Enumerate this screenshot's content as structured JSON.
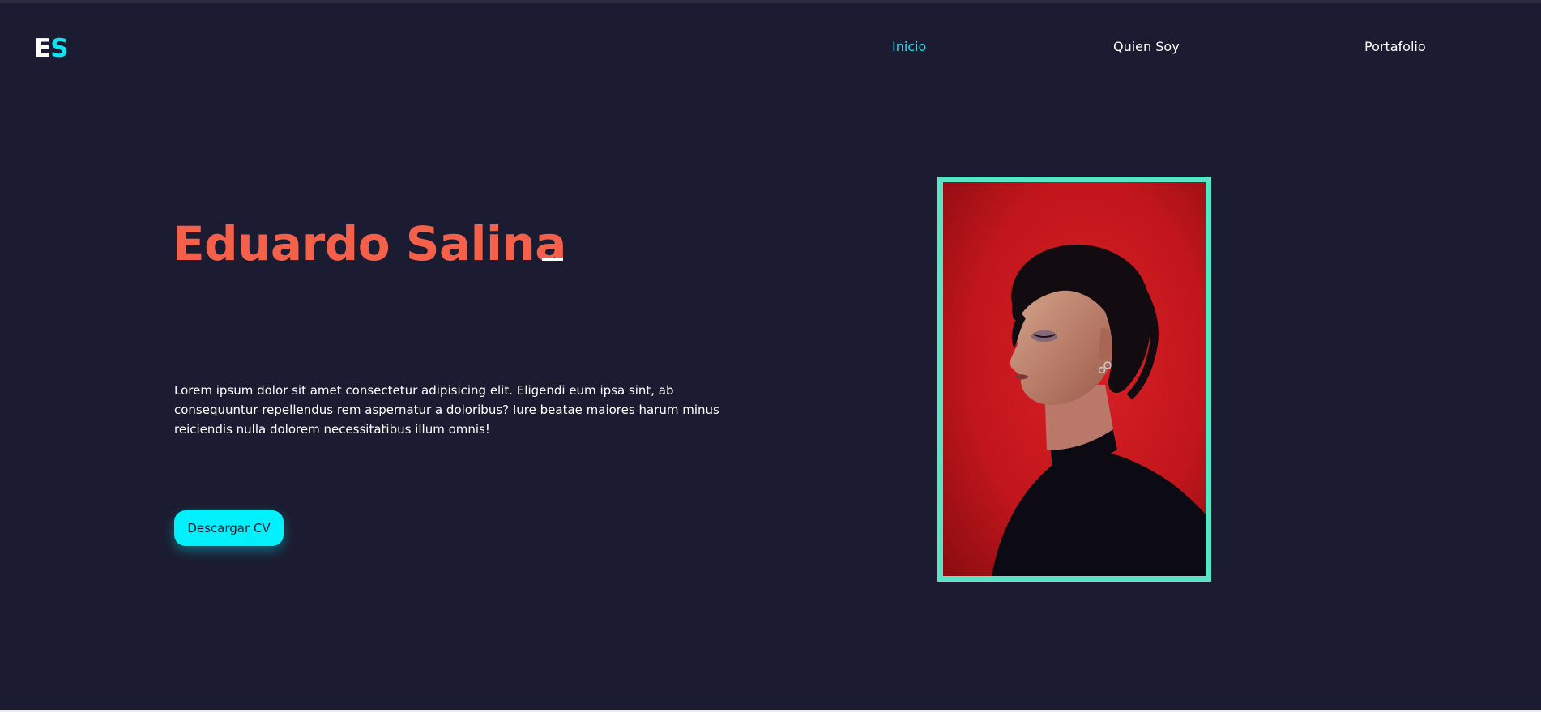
{
  "header": {
    "logo": {
      "first": "E",
      "second": "S"
    },
    "nav": [
      {
        "label": "Inicio",
        "active": true
      },
      {
        "label": "Quien Soy",
        "active": false
      },
      {
        "label": "Portafolio",
        "active": false
      }
    ]
  },
  "hero": {
    "name": "Eduardo Salina",
    "description": "Lorem ipsum dolor sit amet consectetur adipisicing elit. Eligendi eum ipsa sint, ab consequuntur repellendus rem aspernatur a doloribus? Iure beatae maiores harum minus reiciendis nulla dolorem necessitatibus illum omnis!",
    "cv_button": "Descargar CV"
  },
  "colors": {
    "background": "#1b1c31",
    "accent": "#11e2f0",
    "name": "#f4604a",
    "frame": "#58e4c5",
    "photo_background": "#c8181d"
  }
}
